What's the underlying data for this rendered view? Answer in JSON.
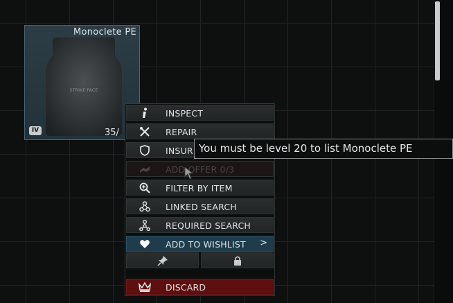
{
  "item": {
    "name": "Monoclete PE",
    "plate_text": "STRIKE FACE",
    "armor_class": "IV",
    "durability": "35/"
  },
  "context_menu": {
    "items": [
      {
        "label": "INSPECT",
        "icon": "info-icon"
      },
      {
        "label": "REPAIR",
        "icon": "repair-tools-icon"
      },
      {
        "label": "INSUR",
        "icon": "shield-icon"
      },
      {
        "label": "ADD OFFER 0/3",
        "icon": "handshake-icon",
        "disabled": true
      },
      {
        "label": "FILTER BY ITEM",
        "icon": "magnifier-plus-icon"
      },
      {
        "label": "LINKED SEARCH",
        "icon": "linked-nodes-icon"
      },
      {
        "label": "REQUIRED SEARCH",
        "icon": "required-nodes-icon"
      },
      {
        "label": "ADD TO WISHLIST",
        "icon": "heart-icon",
        "submenu_arrow": ">"
      },
      {
        "label": "DISCARD",
        "icon": "crown-discard-icon"
      }
    ],
    "pin_icon": "pin-icon",
    "lock_icon": "lock-icon"
  },
  "tooltip": {
    "text": "You must be level 20 to list Monoclete PE"
  },
  "colors": {
    "wishlist_bg": "#1e3c4c",
    "discard_bg": "#5e0f0f",
    "item_bg": "#2d3d46"
  }
}
